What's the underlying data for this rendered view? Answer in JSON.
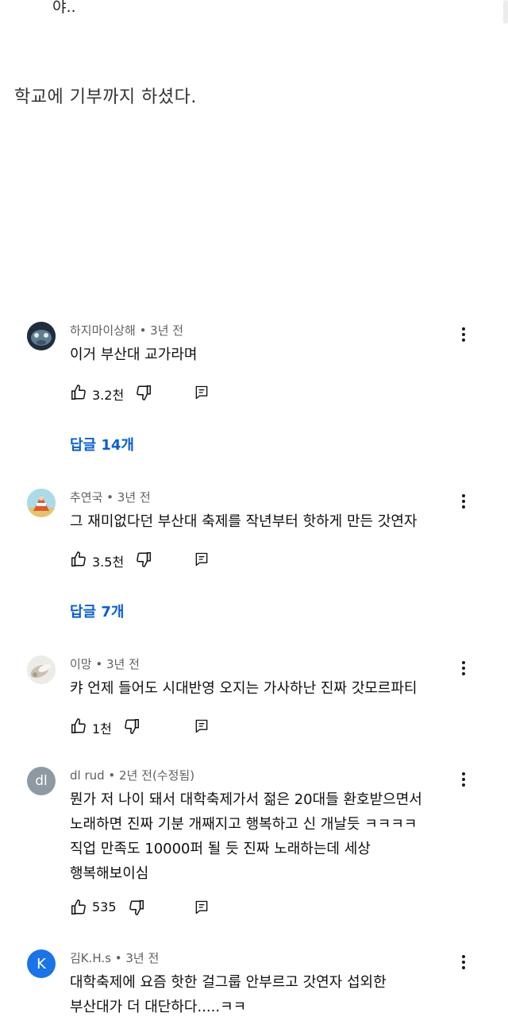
{
  "top_text": "야..",
  "description_text": "학교에 기부까지 하셨다.",
  "colors": {
    "link": "#065fd4",
    "meta": "#606060",
    "avatar_dl": "#8e9aa3",
    "avatar_k": "#1a73e8"
  },
  "comments": [
    {
      "author": "하지마이상해",
      "time": "3년 전",
      "meta": "하지마이상해 • 3년 전",
      "avatar": "photo-avatar",
      "lines": [
        "이거 부산대 교가라며"
      ],
      "likes": "3.2천",
      "replies": "답글 14개"
    },
    {
      "author": "추연국",
      "time": "3년 전",
      "meta": "추연국 • 3년 전",
      "avatar": "photo-avatar",
      "lines": [
        "그 재미없다던 부산대 축제를 작년부터 핫하게 만든 갓연자"
      ],
      "likes": "3.5천",
      "replies": "답글 7개"
    },
    {
      "author": "이망",
      "time": "3년 전",
      "meta": "이망 • 3년 전",
      "avatar": "photo-avatar",
      "lines": [
        "캬 언제 들어도 시대반영 오지는 가사하난 진짜 갓모르파티"
      ],
      "likes": "1천"
    },
    {
      "author": "dl rud",
      "time": "2년 전(수정됨)",
      "meta": "dl rud • 2년 전(수정됨)",
      "avatar_letters": "dl",
      "lines": [
        "뭔가 저 나이 돼서 대학축제가서 젊은 20대들 환호받으면서",
        "노래하면 진짜 기분 개째지고 행복하고 신 개날듯 ㅋㅋㅋㅋ",
        "직업 만족도 10000퍼 될 듯 진짜 노래하는데 세상",
        "행복해보이심"
      ],
      "likes": "535"
    },
    {
      "author": "김K.H.s",
      "time": "3년 전",
      "meta": "김K.H.s • 3년 전",
      "avatar_letters": "K",
      "lines": [
        "대학축제에 요즘 핫한 걸그룹 안부르고 갓연자 섭외한",
        "부산대가 더 대단하다.....ㅋㅋ"
      ]
    }
  ]
}
